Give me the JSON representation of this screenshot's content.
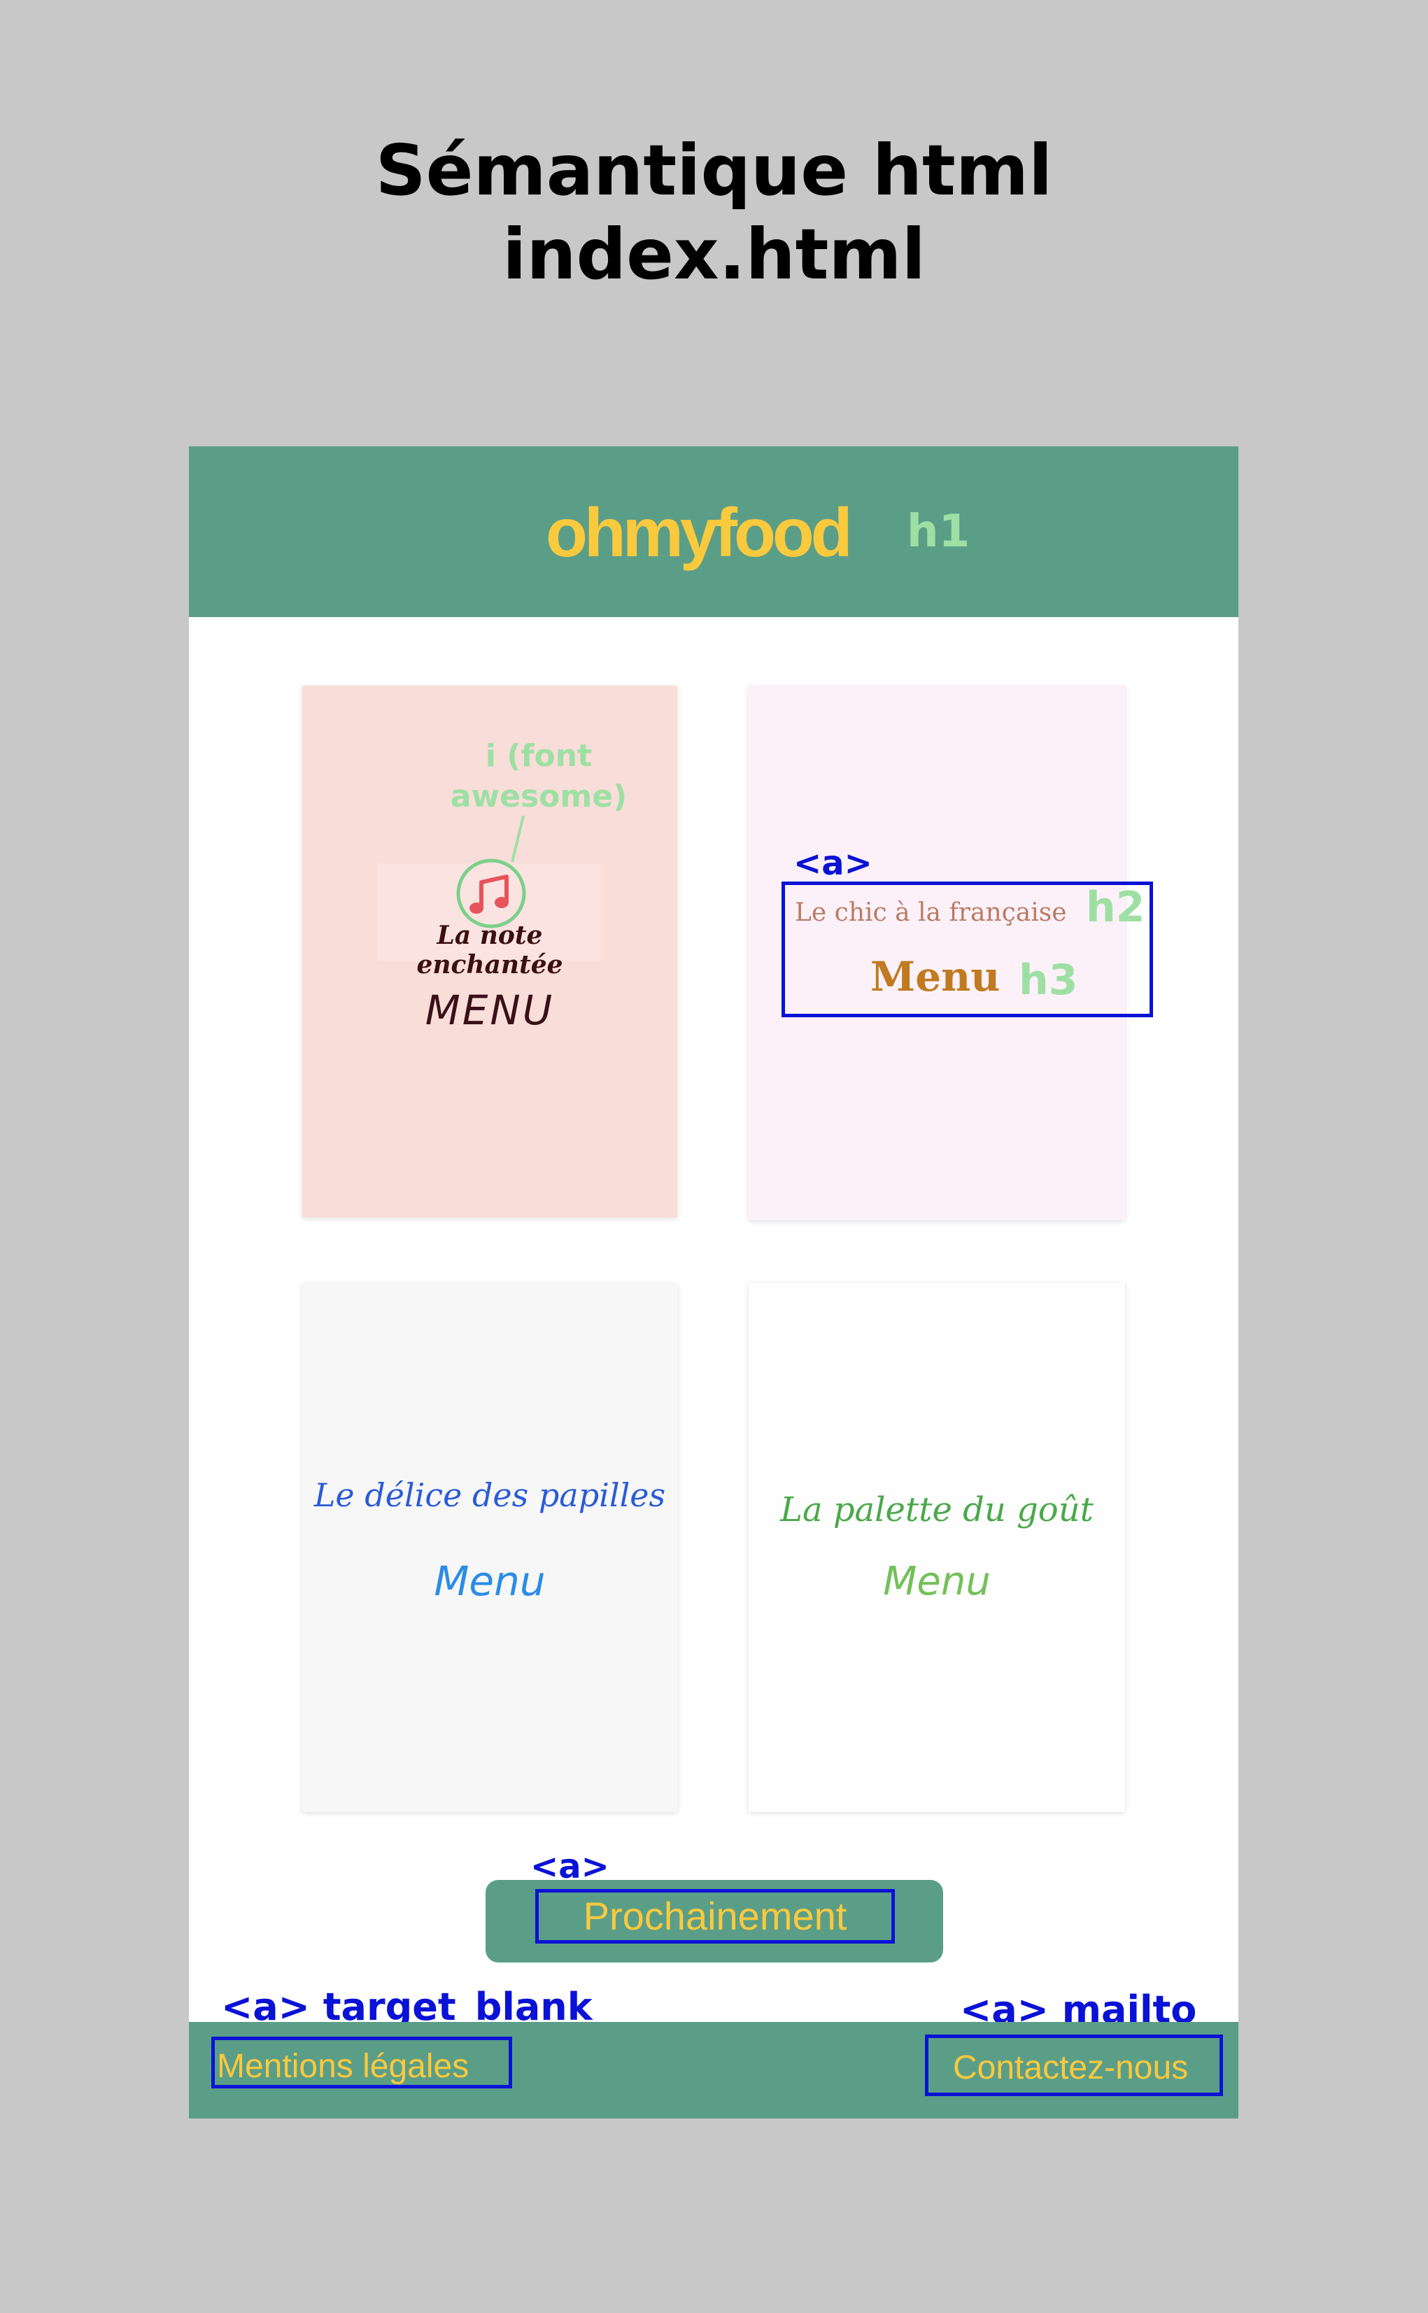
{
  "title_line1": "Sémantique html",
  "title_line2": "index.html",
  "header": {
    "logo": "ohmyfood",
    "tag": "h1"
  },
  "cards": [
    {
      "restaurant": "La note enchantée",
      "menu": "MENU",
      "icon": "music-note-icon",
      "annotation": "i (font\nawesome)"
    },
    {
      "restaurant": "Le chic à la française",
      "menu": "Menu",
      "link_tag": "<a>",
      "restaurant_tag": "h2",
      "menu_tag": "h3"
    },
    {
      "restaurant": "Le délice des papilles",
      "menu": "Menu"
    },
    {
      "restaurant": "La palette du goût",
      "menu": "Menu"
    }
  ],
  "button": {
    "label": "Prochainement",
    "tag": "<a>"
  },
  "footer": {
    "left_link": "Mentions légales",
    "left_tag": "<a> target_blank",
    "right_link": "Contactez-nous",
    "right_tag": "<a> mailto"
  },
  "colors": {
    "background": "#c8c8c8",
    "header_green": "#5b9e87",
    "logo_yellow": "#f9c93e",
    "annotation_green": "#9ee0a4",
    "annotation_blue": "#0a12d6"
  }
}
